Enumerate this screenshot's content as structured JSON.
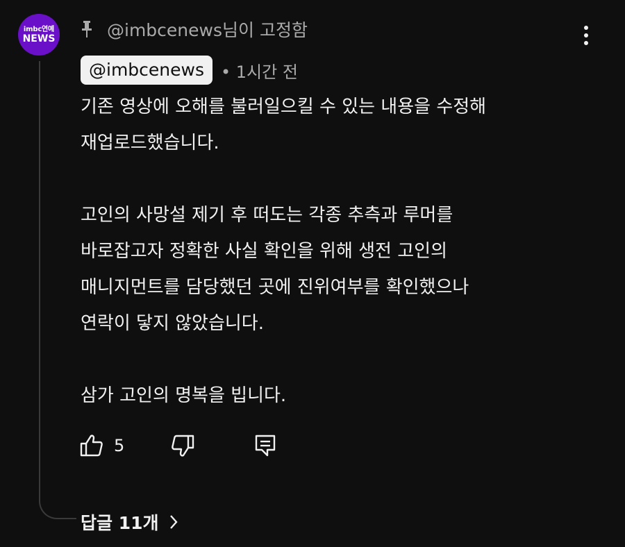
{
  "avatar": {
    "top_text": "imbc연예",
    "bottom_text": "NEWS",
    "color": "#6a10c8"
  },
  "pinned": {
    "text": "@imbcenews님이 고정함",
    "icon": "pin-icon"
  },
  "author": {
    "handle": "@imbcenews",
    "time": "• 1시간 전"
  },
  "comment": {
    "lines": [
      "기존 영상에 오해를 불러일으킬 수 있는 내용을 수정해",
      "재업로드했습니다.",
      "",
      "고인의 사망설 제기 후 떠도는 각종 추측과 루머를",
      "바로잡고자 정확한 사실 확인을 위해 생전 고인의",
      "매니지먼트를 담당했던 곳에 진위여부를 확인했으나",
      "연락이 닿지 않았습니다.",
      "",
      "삼가 고인의 명복을 빕니다."
    ]
  },
  "actions": {
    "like_count": "5",
    "like_icon": "thumbs-up-icon",
    "dislike_icon": "thumbs-down-icon",
    "reply_icon": "reply-icon"
  },
  "replies": {
    "label": "답글 11개",
    "icon": "chevron-right-icon"
  },
  "menu": {
    "icon": "more-vertical-icon"
  }
}
